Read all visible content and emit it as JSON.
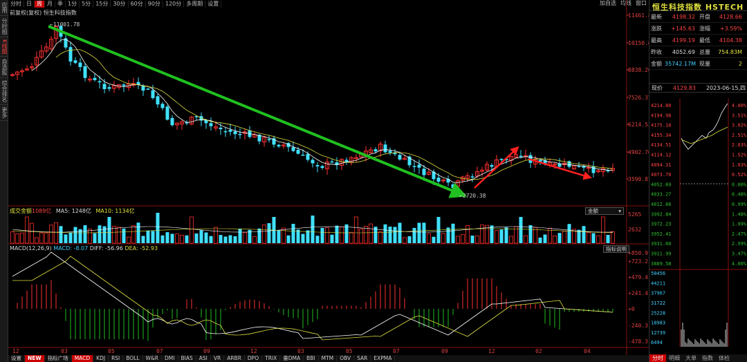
{
  "left_tabs": [
    {
      "label": "应用",
      "active": false
    },
    {
      "label": "分时图",
      "active": false
    },
    {
      "label": "K线图",
      "active": true
    },
    {
      "label": "自选股",
      "active": false
    },
    {
      "label": "综合排名",
      "active": false
    },
    {
      "label": "更多",
      "active": false
    }
  ],
  "toolbar": {
    "items": [
      "分时",
      "日",
      "周",
      "月",
      "季",
      "1分",
      "5分",
      "15分",
      "30分",
      "60分",
      "90分",
      "120分",
      "多周期",
      "设置"
    ],
    "active_index": 2,
    "right_items": [
      "加自选",
      "均线",
      "窗口"
    ]
  },
  "subtitle": "前复权(复权)  恒生科技指数",
  "chart_labels": {
    "high_marker": "11001.78",
    "low_marker": "2720.38"
  },
  "price_axis": [
    "11461.86",
    "10150.03",
    "8838.20",
    "7526.37",
    "6214.53",
    "4902.70",
    "3590.87"
  ],
  "date_axis": [
    "12",
    "03",
    "05",
    "07",
    "09",
    "12",
    "03",
    "05",
    "07",
    "09",
    "12",
    "02",
    "04"
  ],
  "volume_panel": {
    "label_name": "成交金额",
    "label_value": "1089亿",
    "ma5": "MA5: 1248亿",
    "ma10": "MA10: 1134亿",
    "selector": "金额",
    "axis": [
      "5265",
      "2632"
    ]
  },
  "macd_panel": {
    "label": "MACD(12,26,9)",
    "macd": "MACD: -8.07",
    "diff": "DIFF: -56.96",
    "dea": "DEA: -52.93",
    "button": "指标说明",
    "axis": [
      "+850.9",
      "+723.2",
      "+479.4",
      "+241.4",
      "+0",
      "-240.3",
      "-478.3"
    ]
  },
  "indicator_tabs": [
    "设置",
    "NEW",
    "指标广场",
    "MACD",
    "KDJ",
    "RSI",
    "BOLL",
    "W&R",
    "DMI",
    "BIAS",
    "ASI",
    "VR",
    "ARBR",
    "DPO",
    "TRIX",
    "量DMA",
    "BBI",
    "MTM",
    "OBV",
    "SAR",
    "EXPMA"
  ],
  "indicator_active": "MACD",
  "right_panel": {
    "title": "恒生科技指数 HSTECH",
    "quote_rows": [
      {
        "l1": "最新",
        "v1": "4198.32",
        "c1": "red",
        "l2": "开盘",
        "v2": "4128.66",
        "c2": "red"
      },
      {
        "l1": "涨跌",
        "v1": "+145.63",
        "c1": "red",
        "l2": "涨幅",
        "v2": "+3.59%",
        "c2": "red"
      },
      {
        "l1": "最高",
        "v1": "4199.19",
        "c1": "red",
        "l2": "最低",
        "v2": "4104.38",
        "c2": "red"
      },
      {
        "l1": "昨收",
        "v1": "4052.69",
        "c1": "white",
        "l2": "总量",
        "v2": "754.83M",
        "c2": "yellow"
      },
      {
        "l1": "金额",
        "v1": "35742.17M",
        "c1": "cyan",
        "l2": "现量",
        "v2": "2",
        "c2": "yellow"
      }
    ],
    "time_label": "现价",
    "time_price": "4129.83",
    "time_date": "2023-06-15,四",
    "mini_left_axis": [
      "4214.80",
      "4194.98",
      "4175.16",
      "4155.34",
      "4134.51",
      "4114.12",
      "4094.31",
      "4073.70",
      "4052.69",
      "4033.27",
      "4012.66",
      "3992.84",
      "3972.23",
      "3952.41",
      "3931.60",
      "3911.99",
      "3889.58",
      "50456",
      "44211",
      "37967",
      "31722",
      "25228",
      "18983",
      "12739",
      "6494"
    ],
    "mini_right_axis": [
      "4.00%",
      "3.51%",
      "3.02%",
      "2.51%",
      "2.03%",
      "1.52%",
      "1.03%",
      "0.52%",
      "0.00%",
      "0.48%",
      "0.99%",
      "1.48%",
      "1.99%",
      "2.47%",
      "2.99%",
      "3.47%",
      "4.00%"
    ],
    "bottom_tabs": [
      "分时",
      "明细",
      "大单",
      "指数",
      "体检"
    ]
  },
  "colors": {
    "up": "#ff3030",
    "down": "#40e0ff",
    "ma_white": "#ffffff",
    "ma_yellow": "#e0e040",
    "trend_green": "#20c020",
    "trend_red": "#ff2020"
  }
}
